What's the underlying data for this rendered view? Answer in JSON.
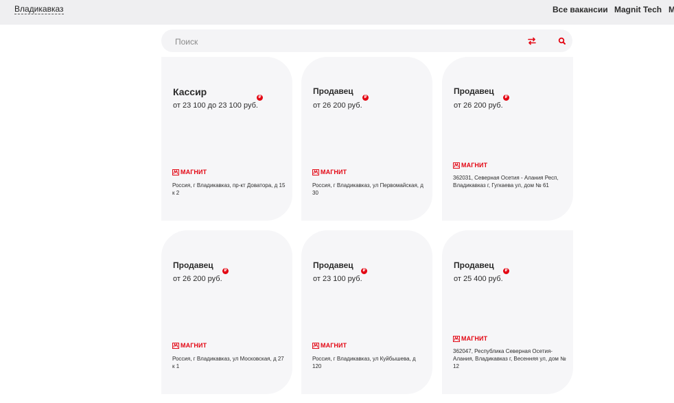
{
  "header": {
    "city": "Владикавказ",
    "nav": [
      "Все вакансии",
      "Magnit Tech",
      "М"
    ]
  },
  "search": {
    "placeholder": "Поиск"
  },
  "colors": {
    "accent": "#e30613",
    "card_bg": "#f6f6f8",
    "topbar_bg": "#efeff1"
  },
  "cards": [
    {
      "title": "Кассир",
      "salary": "от 23 100 до 23 100 руб.",
      "currency_badge": "₽",
      "brand": "МАГНИТ",
      "address": "Россия, г Владикавказ, пр-кт Доватора, д 15 к 2"
    },
    {
      "title": "Продавец",
      "salary": "от 26 200 руб.",
      "currency_badge": "₽",
      "brand": "МАГНИТ",
      "address": "Россия, г Владикавказ, ул Первомайская, д 30"
    },
    {
      "title": "Продавец",
      "salary": "от 26 200 руб.",
      "currency_badge": "₽",
      "brand": "МАГНИТ",
      "address": "362031, Северная Осетия - Алания Респ, Владикавказ г, Гугкаева ул, дом № 61"
    },
    {
      "title": "Продавец",
      "salary": "от 26 200 руб.",
      "currency_badge": "₽",
      "brand": "МАГНИТ",
      "address": "Россия, г Владикавказ, ул Московская, д 27 к 1"
    },
    {
      "title": "Продавец",
      "salary": "от 23 100 руб.",
      "currency_badge": "₽",
      "brand": "МАГНИТ",
      "address": "Россия, г Владикавказ, ул Куйбышева, д 120"
    },
    {
      "title": "Продавец",
      "salary": "от 25 400 руб.",
      "currency_badge": "₽",
      "brand": "МАГНИТ",
      "address": "362047, Республика Северная Осетия-Алания, Владикавказ г, Весенняя ул, дом № 12"
    }
  ],
  "icons": {
    "filter": "filter-arrows-icon",
    "search": "search-icon",
    "brand_logo": "magnit-logo-icon",
    "currency": "ruble-icon"
  }
}
